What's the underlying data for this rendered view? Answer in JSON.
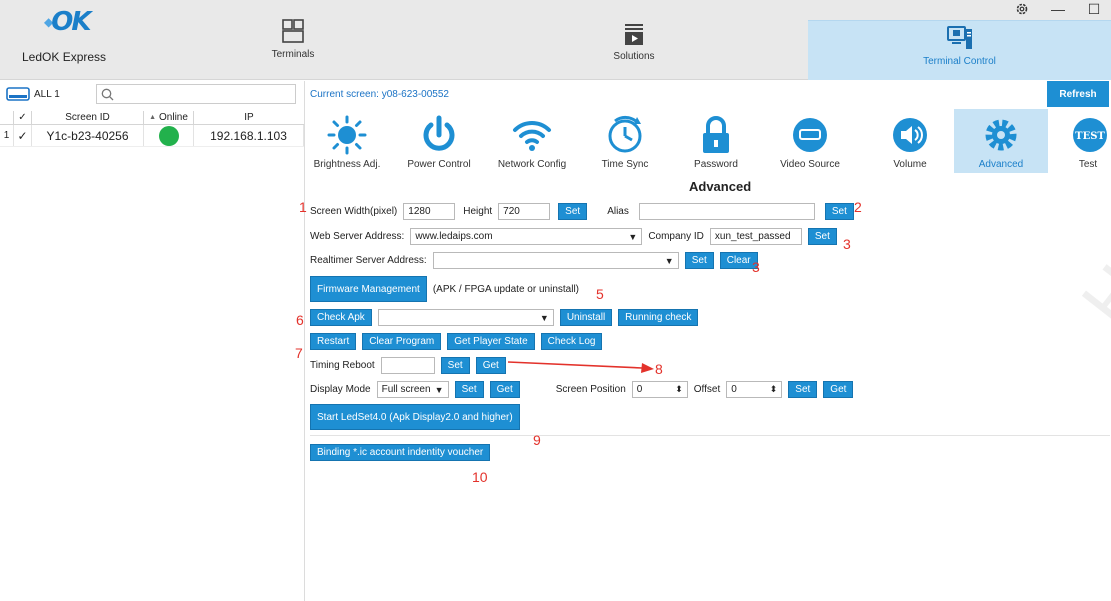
{
  "app": {
    "title": "LedOK Express",
    "logo_text": "OK",
    "accent": "#1e8fd3",
    "active_bg": "#c7e3f5"
  },
  "nav": [
    {
      "label": "Terminals",
      "icon": "terminals-icon"
    },
    {
      "label": "Solutions",
      "icon": "solutions-icon"
    },
    {
      "label": "Terminal Control",
      "icon": "terminal-control-icon"
    }
  ],
  "window": {
    "settings_icon": "gear-icon",
    "minimize": "—",
    "maximize": "☐"
  },
  "left": {
    "all_label": "ALL 1",
    "search_placeholder": "",
    "columns": {
      "check": "✓",
      "screen_id": "Screen ID",
      "sort": "▲",
      "online": "Online",
      "ip": "IP"
    },
    "rows": [
      {
        "num": "1",
        "checked": "✓",
        "screen_id": "Y1c-b23-40256",
        "online": "green",
        "ip": "192.168.1.103"
      }
    ]
  },
  "right": {
    "current_screen": "Current screen: y08-623-00552",
    "refresh": "Refresh",
    "functions": [
      {
        "label": "Brightness Adj.",
        "icon": "brightness-icon"
      },
      {
        "label": "Power Control",
        "icon": "power-icon"
      },
      {
        "label": "Network Config",
        "icon": "wifi-icon"
      },
      {
        "label": "Time Sync",
        "icon": "clock-icon"
      },
      {
        "label": "Password",
        "icon": "lock-icon"
      },
      {
        "label": "Video Source",
        "icon": "video-source-icon"
      },
      {
        "label": "Volume",
        "icon": "volume-icon"
      },
      {
        "label": "Advanced",
        "icon": "gear-icon"
      },
      {
        "label": "Test",
        "icon": "test-icon",
        "badge": "TEST"
      }
    ],
    "advanced": {
      "title": "Advanced",
      "screen_width_label": "Screen Width(pixel)",
      "screen_width": "1280",
      "height_label": "Height",
      "height": "720",
      "set": "Set",
      "get": "Get",
      "alias_label": "Alias",
      "alias": "",
      "web_server_label": "Web Server Address:",
      "web_server": "www.ledaips.com",
      "company_id_label": "Company ID",
      "company_id": "xun_test_passed",
      "realtimer_label": "Realtimer Server Address:",
      "realtimer": "",
      "clear": "Clear",
      "firmware_btn": "Firmware Management",
      "firmware_note": "(APK / FPGA update or uninstall)",
      "check_apk": "Check Apk",
      "apk_select": "",
      "uninstall": "Uninstall",
      "running_check": "Running check",
      "restart": "Restart",
      "clear_program": "Clear Program",
      "get_player_state": "Get Player State",
      "check_log": "Check Log",
      "timing_reboot_label": "Timing Reboot",
      "timing_reboot": "",
      "display_mode_label": "Display Mode",
      "display_mode": "Full screen",
      "screen_position_label": "Screen Position",
      "screen_position": "0",
      "offset_label": "Offset",
      "offset": "0",
      "start_ledset": "Start LedSet4.0 (Apk Display2.0 and higher)",
      "binding": "Binding *.ic account indentity voucher"
    },
    "annotations": [
      "1",
      "2",
      "3",
      "3",
      "5",
      "6",
      "7",
      "8",
      "9",
      "10"
    ],
    "watermark": "HNOLOGY CO"
  }
}
